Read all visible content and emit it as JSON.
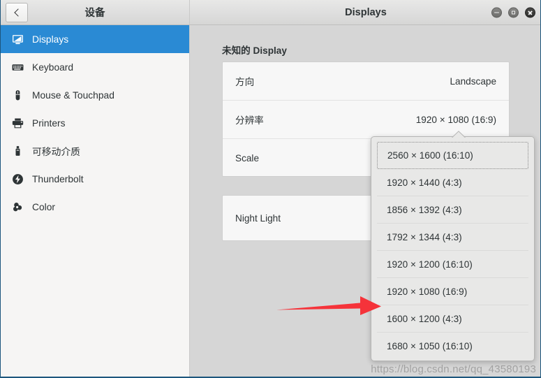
{
  "window": {
    "sidebar_title": "设备",
    "main_title": "Displays",
    "back_label": "‹",
    "controls": {
      "minimize_label": "−",
      "maximize_label": "□",
      "close_label": "×"
    }
  },
  "sidebar": {
    "items": [
      {
        "label": "Displays",
        "icon": "monitor-icon",
        "selected": true
      },
      {
        "label": "Keyboard",
        "icon": "keyboard-icon",
        "selected": false
      },
      {
        "label": "Mouse & Touchpad",
        "icon": "mouse-icon",
        "selected": false
      },
      {
        "label": "Printers",
        "icon": "printer-icon",
        "selected": false
      },
      {
        "label": "可移动介质",
        "icon": "usb-drive-icon",
        "selected": false
      },
      {
        "label": "Thunderbolt",
        "icon": "thunderbolt-icon",
        "selected": false
      },
      {
        "label": "Color",
        "icon": "color-wheel-icon",
        "selected": false
      }
    ]
  },
  "main": {
    "display_name": "未知的 Display",
    "rows": [
      {
        "label": "方向",
        "value": "Landscape"
      },
      {
        "label": "分辨率",
        "value": "1920 × 1080 (16:9)"
      },
      {
        "label": "Scale",
        "value": ""
      }
    ],
    "night_light": {
      "label": "Night Light",
      "value": ""
    }
  },
  "popover": {
    "name": "resolution-dropdown",
    "items": [
      {
        "label": "2560 × 1600 (16:10)",
        "focused": true
      },
      {
        "label": "1920 × 1440 (4:3)",
        "focused": false
      },
      {
        "label": "1856 × 1392 (4:3)",
        "focused": false
      },
      {
        "label": "1792 × 1344 (4:3)",
        "focused": false
      },
      {
        "label": "1920 × 1200 (16:10)",
        "focused": false
      },
      {
        "label": "1920 × 1080 (16:9)",
        "focused": false
      },
      {
        "label": "1600 × 1200 (4:3)",
        "focused": false
      },
      {
        "label": "1680 × 1050 (16:10)",
        "focused": false
      }
    ]
  },
  "annotation": {
    "arrow_color": "#f5333a",
    "arrow_target": "1920 × 1080 (16:9)"
  },
  "watermark": {
    "text": "https://blog.csdn.net/qq_43580193"
  },
  "colors": {
    "accent": "#2a8ad4",
    "window_bg": "#d6d6d6",
    "sidebar_bg": "#f6f5f4",
    "card_bg": "#f7f7f7",
    "popover_bg": "#e8e8e7",
    "text": "#2e3436",
    "window_border": "#1d567d"
  }
}
